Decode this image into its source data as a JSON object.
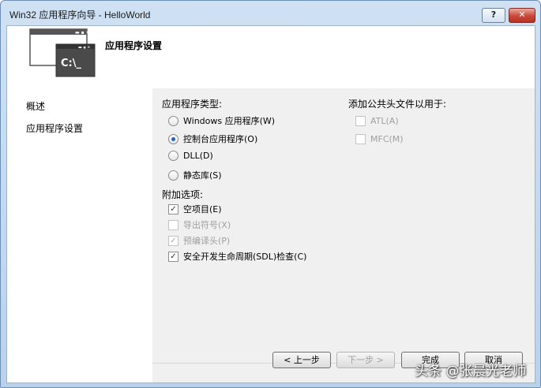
{
  "window": {
    "title": "Win32 应用程序向导 - HelloWorld",
    "help_label": "?",
    "close_label": "✕"
  },
  "header": {
    "title": "应用程序设置",
    "console_icon_text": "C:\\_"
  },
  "sidebar": {
    "items": [
      {
        "label": "概述"
      },
      {
        "label": "应用程序设置"
      }
    ]
  },
  "app_type": {
    "label": "应用程序类型:",
    "options": [
      {
        "label": "Windows 应用程序(W)",
        "selected": false
      },
      {
        "label": "控制台应用程序(O)",
        "selected": true
      },
      {
        "label": "DLL(D)",
        "selected": false
      },
      {
        "label": "静态库(S)",
        "selected": false
      }
    ]
  },
  "additional": {
    "label": "附加选项:",
    "options": [
      {
        "label": "空项目(E)",
        "checked": true,
        "enabled": true
      },
      {
        "label": "导出符号(X)",
        "checked": false,
        "enabled": false
      },
      {
        "label": "预编译头(P)",
        "checked": true,
        "enabled": false
      },
      {
        "label": "安全开发生命周期(SDL)检查(C)",
        "checked": true,
        "enabled": true
      }
    ]
  },
  "common_headers": {
    "label": "添加公共头文件以用于:",
    "options": [
      {
        "label": "ATL(A)",
        "checked": false,
        "enabled": false
      },
      {
        "label": "MFC(M)",
        "checked": false,
        "enabled": false
      }
    ]
  },
  "buttons": {
    "prev": "< 上一步",
    "next": "下一步 >",
    "finish": "完成",
    "cancel": "取消"
  },
  "watermark": "头条 @张晨光老师"
}
